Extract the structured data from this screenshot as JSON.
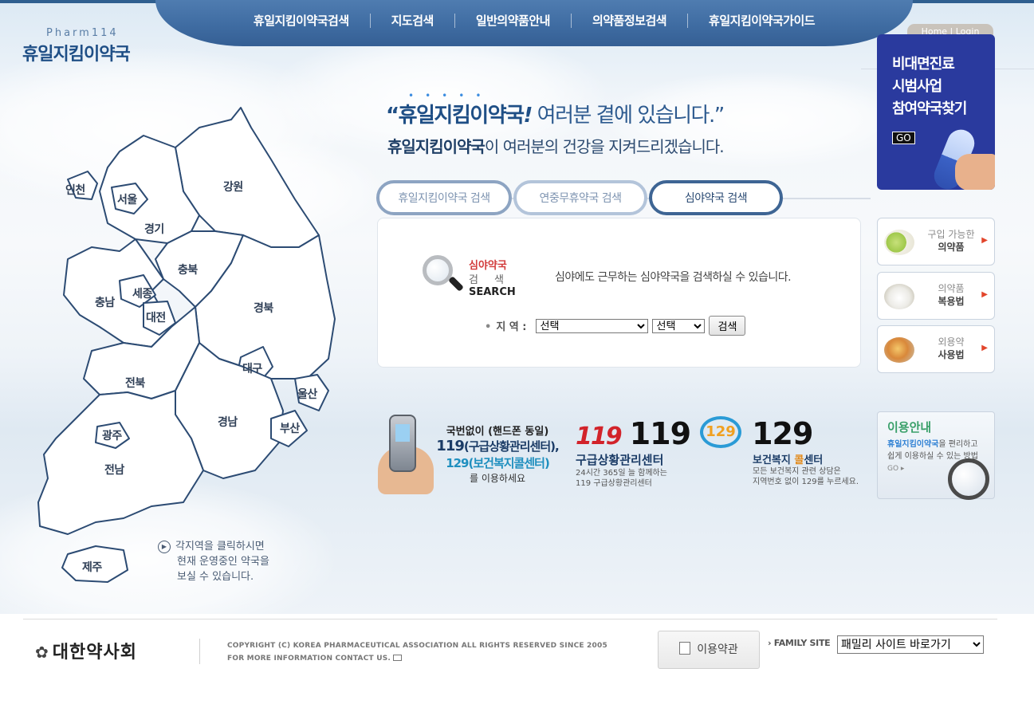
{
  "logo": {
    "en": "Pharm114",
    "kr": "휴일지킴이약국"
  },
  "nav": {
    "items": [
      "휴일지킴이약국검색",
      "지도검색",
      "일반의약품안내",
      "의약품정보검색",
      "휴일지킴이약국가이드"
    ],
    "home_login": "Home | Login"
  },
  "slogan": {
    "quote_bold": "“휴일지킴이약국",
    "quote_bang": "!",
    "quote_rest": " 여러분 곁에 있습니다.”",
    "line2_bold": "휴일지킴이약국",
    "line2_rest": "이 여러분의 건강을 지켜드리겠습니다."
  },
  "tabs": [
    "휴일지킴이약국 검색",
    "연중무휴약국 검색",
    "심야약국 검색"
  ],
  "search": {
    "logo_red": "심야약국",
    "logo_gray": "검색",
    "logo_en": "SEARCH",
    "description": "심야에도 근무하는 심야약국을 검색하실 수 있습니다.",
    "region_label": "지 역 :",
    "select1": "선택",
    "select2": "선택",
    "button": "검색"
  },
  "promo": {
    "line1": "비대면진료",
    "line2": "시범사업",
    "line3": "참여약국찾기",
    "go": "GO"
  },
  "side_menu": [
    {
      "top": "구입 가능한",
      "bottom": "의약품"
    },
    {
      "top": "의약품",
      "bottom": "복용법"
    },
    {
      "top": "외용약",
      "bottom": "사용법"
    }
  ],
  "emergency": {
    "phone_line1": "국번없이 (핸드폰 동일)",
    "phone_line2_num": "119",
    "phone_line2_txt": "(구급상황관리센터),",
    "phone_line3": "129(보건복지콜센터)",
    "phone_line4": "를 이용하세요",
    "c119_logo": "119",
    "c119_num": "119",
    "c119_title": "구급상황관리센터",
    "c119_desc1": "24시간 365일 늘 함께하는",
    "c119_desc2": "119 구급상황관리센터",
    "c129_logo": "129",
    "c129_num": "129",
    "c129_title_a": "보건복지 ",
    "c129_title_b": "콜",
    "c129_title_c": "센터",
    "c129_desc1": "모든 보건복지 관련 상담은",
    "c129_desc2": "지역번호 없이 129를 누르세요."
  },
  "guide": {
    "title": "이용안내",
    "desc_bold": "휴일지킴이약국",
    "desc_rest": "을 편리하고 쉽게 이용하실 수 있는 방법",
    "go": "GO ▸"
  },
  "map": {
    "regions": [
      "인천",
      "서울",
      "강원",
      "경기",
      "충북",
      "세종",
      "충남",
      "대전",
      "경북",
      "대구",
      "전북",
      "울산",
      "경남",
      "부산",
      "광주",
      "전남",
      "제주"
    ],
    "note1": "각지역을 클릭하시면",
    "note2": "현재 운영중인 약국을",
    "note3": "보실 수 있습니다."
  },
  "footer": {
    "org": "대한약사회",
    "copyright1": "COPYRIGHT (C) KOREA PHARMACEUTICAL ASSOCIATION ALL RIGHTS RESERVED SINCE 2005",
    "copyright2": "FOR MORE INFORMATION CONTACT US.",
    "terms": "이용약관",
    "family_label": "› FAMILY SITE",
    "family_select": "패밀리 사이트 바로가기"
  },
  "colors": {
    "nav": "#3f6ca2",
    "promo": "#2a3a9e",
    "accent_red": "#d2232a"
  }
}
